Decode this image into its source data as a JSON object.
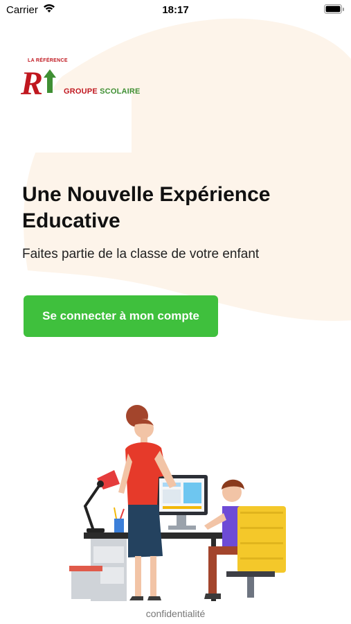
{
  "status_bar": {
    "carrier": "Carrier",
    "time": "18:17",
    "icons": [
      "wifi-icon",
      "battery-icon"
    ]
  },
  "logo": {
    "tagline": "LA RÉFÉRENCE",
    "name_part1": "GROUPE ",
    "name_part2": "SCOLAIRE",
    "colors": {
      "red": "#c0171f",
      "green": "#3f8f33"
    }
  },
  "hero": {
    "title": "Une Nouvelle Expérience Educative",
    "subtitle": "Faites partie de la classe de votre enfant"
  },
  "actions": {
    "login_label": "Se connecter à mon compte"
  },
  "footer": {
    "privacy_label": "confidentialité"
  },
  "colors": {
    "accent_green": "#3fc03d",
    "background_blob": "#fdf4ea"
  }
}
